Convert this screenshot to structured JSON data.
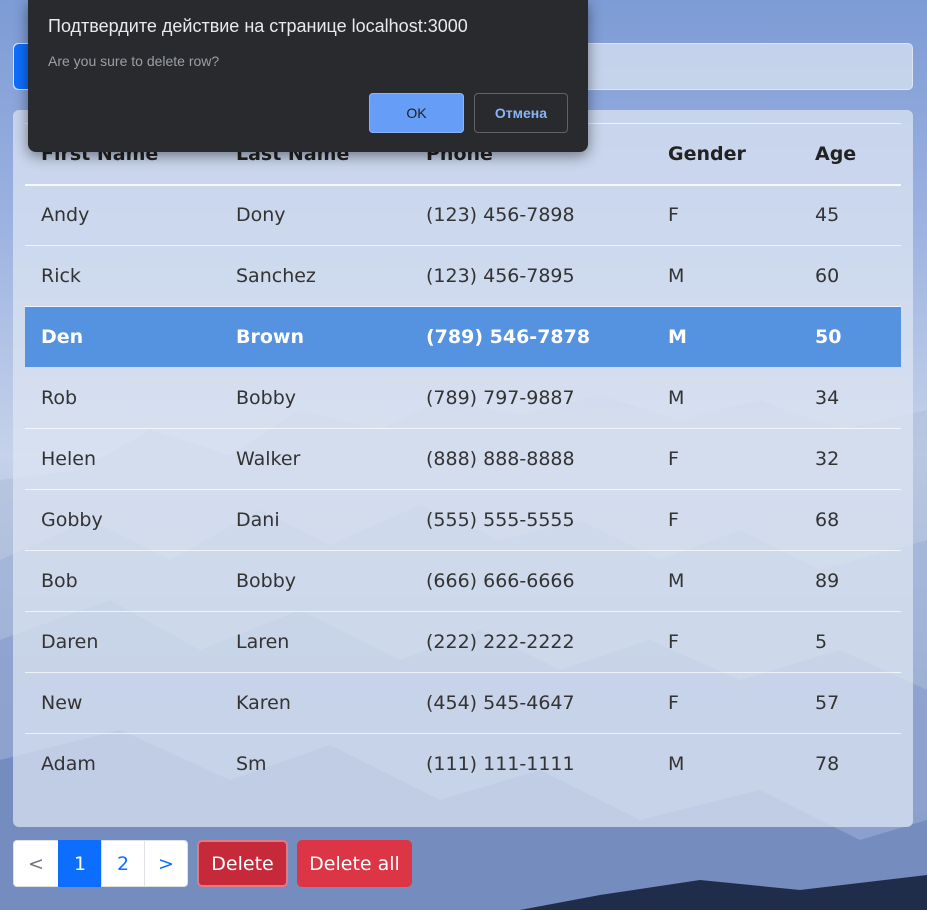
{
  "table": {
    "headers": [
      "First Name",
      "Last Name",
      "Phone",
      "Gender",
      "Age"
    ],
    "rows": [
      [
        "Andy",
        "Dony",
        "(123) 456-7898",
        "F",
        "45"
      ],
      [
        "Rick",
        "Sanchez",
        "(123) 456-7895",
        "M",
        "60"
      ],
      [
        "Den",
        "Brown",
        "(789) 546-7878",
        "M",
        "50"
      ],
      [
        "Rob",
        "Bobby",
        "(789) 797-9887",
        "M",
        "34"
      ],
      [
        "Helen",
        "Walker",
        "(888) 888-8888",
        "F",
        "32"
      ],
      [
        "Gobby",
        "Dani",
        "(555) 555-5555",
        "F",
        "68"
      ],
      [
        "Bob",
        "Bobby",
        "(666) 666-6666",
        "M",
        "89"
      ],
      [
        "Daren",
        "Laren",
        "(222) 222-2222",
        "F",
        "5"
      ],
      [
        "New",
        "Karen",
        "(454) 545-4647",
        "F",
        "57"
      ],
      [
        "Adam",
        "Sm",
        "(111) 111-1111",
        "M",
        "78"
      ]
    ],
    "selected_row": 2
  },
  "pagination": {
    "prev": "<",
    "pages": [
      "1",
      "2"
    ],
    "active_page": "1",
    "next": ">"
  },
  "actions": {
    "delete_label": "Delete",
    "delete_all_label": "Delete all"
  },
  "dialog": {
    "title": "Подтвердите действие на странице localhost:3000",
    "message": "Are you sure to delete row?",
    "ok_label": "OK",
    "cancel_label": "Отмена"
  },
  "colors": {
    "primary": "#0d6efd",
    "selected_row": "#5592df",
    "danger": "#dc3545",
    "dialog_bg": "#292a2d",
    "dialog_ok": "#669df6"
  }
}
